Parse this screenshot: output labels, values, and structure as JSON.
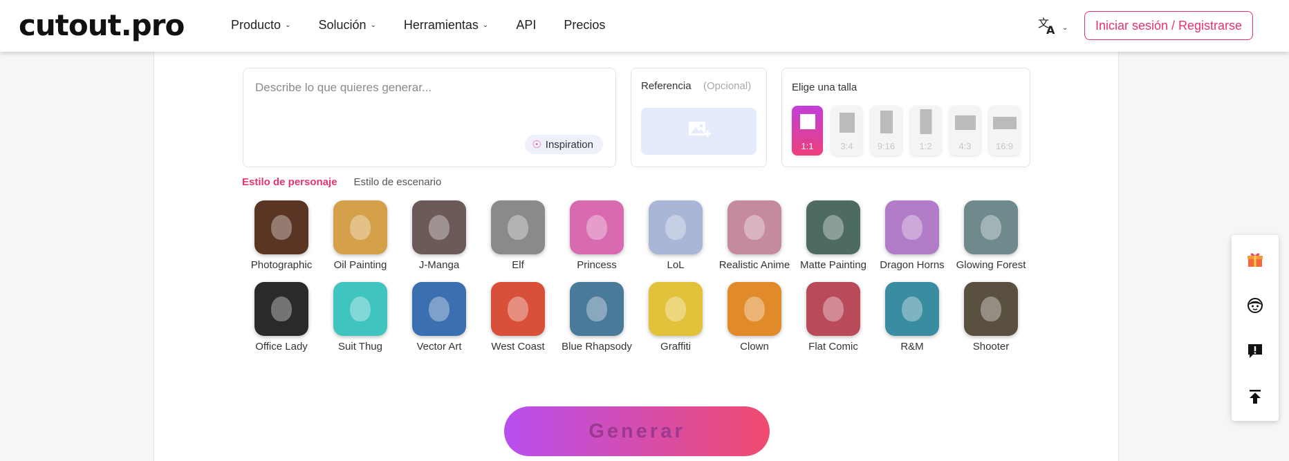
{
  "header": {
    "logo": "cutout.pro",
    "nav": [
      {
        "label": "Producto",
        "has_dropdown": true
      },
      {
        "label": "Solución",
        "has_dropdown": true
      },
      {
        "label": "Herramientas",
        "has_dropdown": true
      },
      {
        "label": "API",
        "has_dropdown": false
      },
      {
        "label": "Precios",
        "has_dropdown": false
      }
    ],
    "language_icon": "translate-icon",
    "login_label": "Iniciar sesión / Registrarse"
  },
  "prompt": {
    "placeholder": "Describe lo que quieres generar...",
    "inspiration_label": "Inspiration",
    "inspiration_icon": "lightbulb-icon"
  },
  "reference": {
    "title": "Referencia",
    "optional": "(Opcional)",
    "upload_icon": "add-image-icon"
  },
  "size": {
    "title": "Elige una talla",
    "ratios": [
      "1:1",
      "3:4",
      "9:16",
      "1:2",
      "4:3",
      "16:9"
    ],
    "selected": "1:1"
  },
  "tabs": {
    "character": "Estilo de personaje",
    "scene": "Estilo de escenario",
    "active": "character"
  },
  "styles": [
    {
      "label": "Photographic",
      "color": "#5a3524"
    },
    {
      "label": "Oil Painting",
      "color": "#d4a04a"
    },
    {
      "label": "J-Manga",
      "color": "#6b5a58"
    },
    {
      "label": "Elf",
      "color": "#8a8a8a"
    },
    {
      "label": "Princess",
      "color": "#d86ab0"
    },
    {
      "label": "LoL",
      "color": "#a9b6d8"
    },
    {
      "label": "Realistic Anime",
      "color": "#c58a9c"
    },
    {
      "label": "Matte Painting",
      "color": "#4e6b62"
    },
    {
      "label": "Dragon Horns",
      "color": "#b27cc8"
    },
    {
      "label": "Glowing Forest",
      "color": "#6f8a8c"
    },
    {
      "label": "Office Lady",
      "color": "#2a2a2a"
    },
    {
      "label": "Suit Thug",
      "color": "#3fc4c0"
    },
    {
      "label": "Vector Art",
      "color": "#3a6fb0"
    },
    {
      "label": "West Coast",
      "color": "#d8503a"
    },
    {
      "label": "Blue Rhapsody",
      "color": "#4a7a9a"
    },
    {
      "label": "Graffiti",
      "color": "#e2c23a"
    },
    {
      "label": "Clown",
      "color": "#e08a2a"
    },
    {
      "label": "Flat Comic",
      "color": "#b84a5a"
    },
    {
      "label": "R&M",
      "color": "#3a8ca0"
    },
    {
      "label": "Shooter",
      "color": "#5a5040"
    }
  ],
  "generate_label": "Generar",
  "sidebar": {
    "icons": [
      "gift-icon",
      "support-agent-icon",
      "feedback-icon",
      "back-to-top-icon"
    ]
  },
  "colors": {
    "accent": "#e6336b",
    "gradient_start": "#b84ff0",
    "gradient_end": "#f04b6f"
  }
}
